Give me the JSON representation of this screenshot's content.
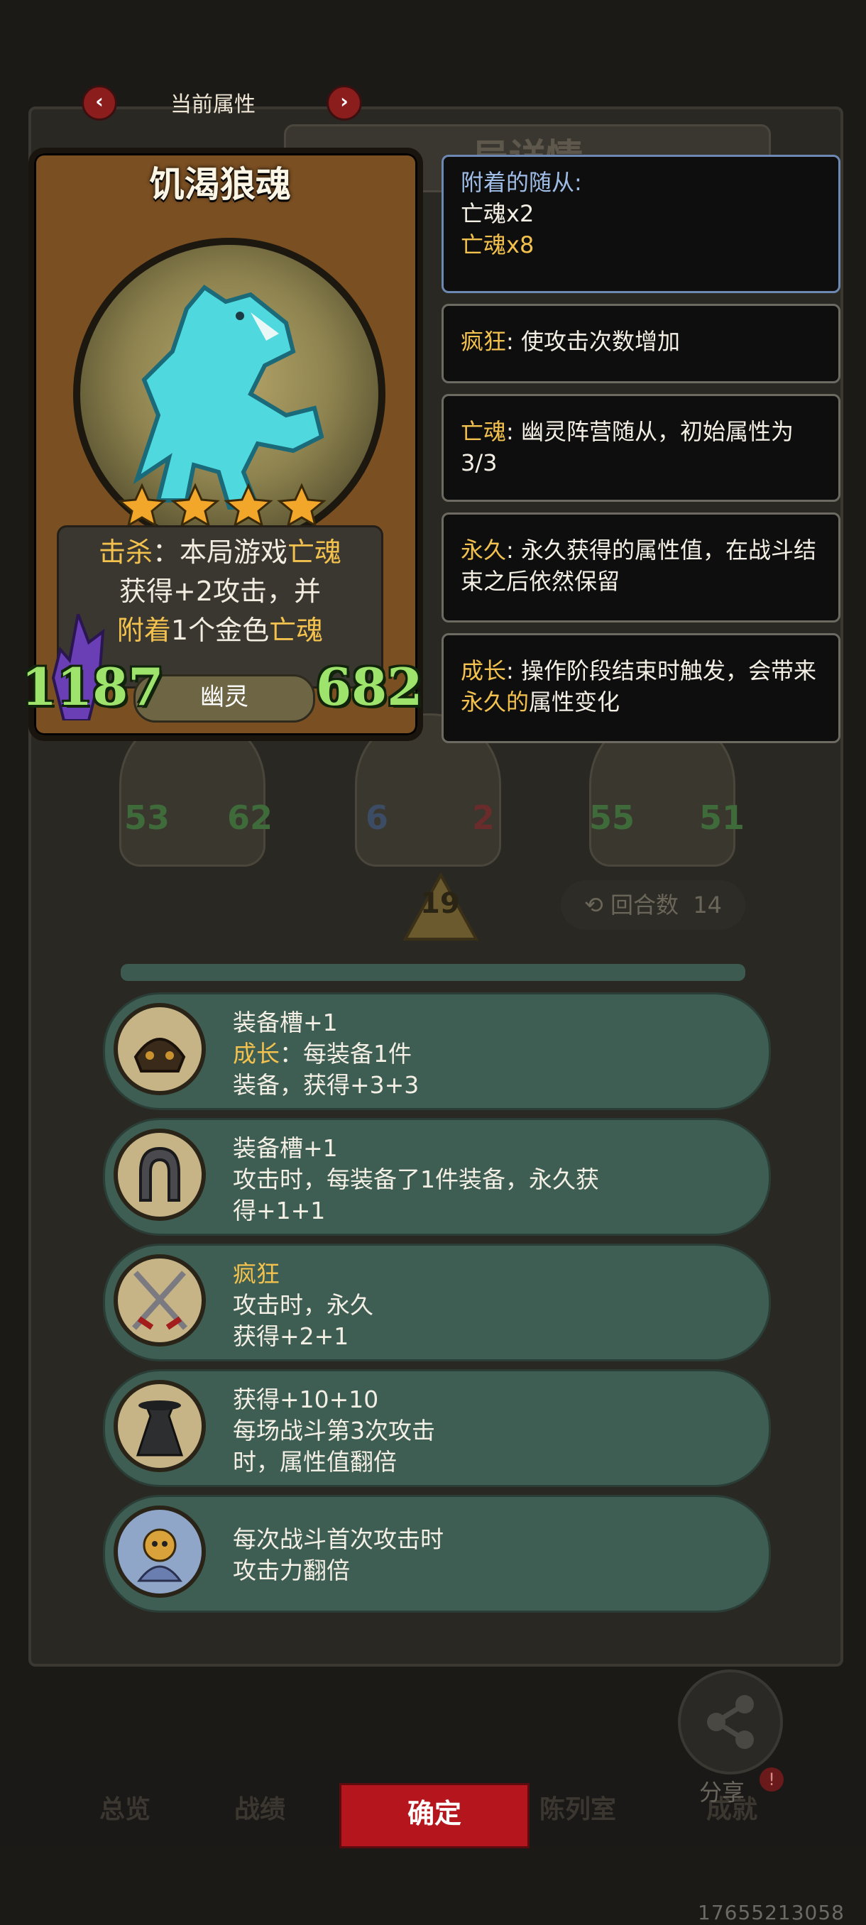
{
  "header": {
    "title": "当前属性",
    "prev_icon": "chevron-left-icon",
    "next_icon": "chevron-right-icon"
  },
  "card": {
    "name": "饥渴狼魂",
    "stars": 4,
    "desc_line1_a": "击杀",
    "desc_line1_b": "：本局游戏",
    "desc_line1_c": "亡魂",
    "desc_line2": "获得+2攻击，并",
    "desc_line3_a": "附着",
    "desc_line3_b": "1个金色",
    "desc_line3_c": "亡魂",
    "tribe": "幽灵",
    "attack": "1187",
    "health": "682"
  },
  "keywords": {
    "attached_title": "附着的随从:",
    "attached_1": "亡魂x2",
    "attached_2": "亡魂x8",
    "frenzy_name": "疯狂",
    "frenzy_desc": ": 使攻击次数增加",
    "soul_name": "亡魂",
    "soul_desc": ": 幽灵阵营随从，初始属性为3/3",
    "perm_name": "永久",
    "perm_desc": ": 永久获得的属性值，在战斗结束之后依然保留",
    "growth_name": "成长",
    "growth_desc_a": ": 操作阶段结束时触发，会带来",
    "growth_desc_hl": "永久的",
    "growth_desc_b": "属性变化"
  },
  "background": {
    "board_title_hint": "局详情",
    "round_label": "回合数",
    "round_value": "14",
    "turn_badge": "19",
    "units": [
      {
        "atk": "53",
        "hp": "62"
      },
      {
        "atk": "6",
        "hp": "2"
      },
      {
        "atk": "55",
        "hp": "51"
      }
    ]
  },
  "perks": [
    {
      "icon": "armor-icon",
      "l1": "装备槽+1",
      "l2_kw": "成长",
      "l2": "：每装备1件",
      "l3": "装备，获得+3+3"
    },
    {
      "icon": "horseshoe-icon",
      "l1": "装备槽+1",
      "l2": "攻击时，每装备了1件装备，永久获",
      "l3": "得+1+1"
    },
    {
      "icon": "crossed-swords-icon",
      "l1_kw": "疯狂",
      "l2": "攻击时，永久",
      "l3": "获得+2+1"
    },
    {
      "icon": "cloaked-figure-icon",
      "l1": "获得+10+10",
      "l2": "每场战斗第3次攻击",
      "l3": "时，属性值翻倍"
    },
    {
      "icon": "monster-icon",
      "l1": "每次战斗首次攻击时",
      "l2": "攻击力翻倍"
    }
  ],
  "bottom": {
    "confirm": "确定",
    "share": "分享",
    "tabs": [
      "总览",
      "战绩",
      "陈列室",
      "成就"
    ],
    "watermark": "17655213058"
  },
  "colors": {
    "accent_yellow": "#f2c14e",
    "confirm_red": "#b5161d",
    "stat_green": "#9ee36b",
    "perk_bg": "#3e5d53"
  }
}
